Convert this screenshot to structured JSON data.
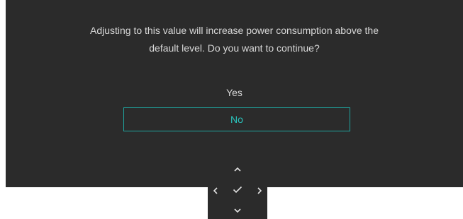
{
  "dialog": {
    "message_line1": "Adjusting to this value will increase power consumption above the",
    "message_line2": "default level. Do you want to continue?",
    "options": [
      {
        "label": "Yes",
        "selected": false
      },
      {
        "label": "No",
        "selected": true
      }
    ]
  },
  "navpad": {
    "up_icon": "chevron-up-icon",
    "left_icon": "chevron-left-icon",
    "ok_icon": "checkmark-icon",
    "right_icon": "chevron-right-icon",
    "down_icon": "chevron-down-icon"
  },
  "colors": {
    "background": "#2b2b2b",
    "text": "#d8d8d8",
    "accent": "#1fa6a0"
  }
}
